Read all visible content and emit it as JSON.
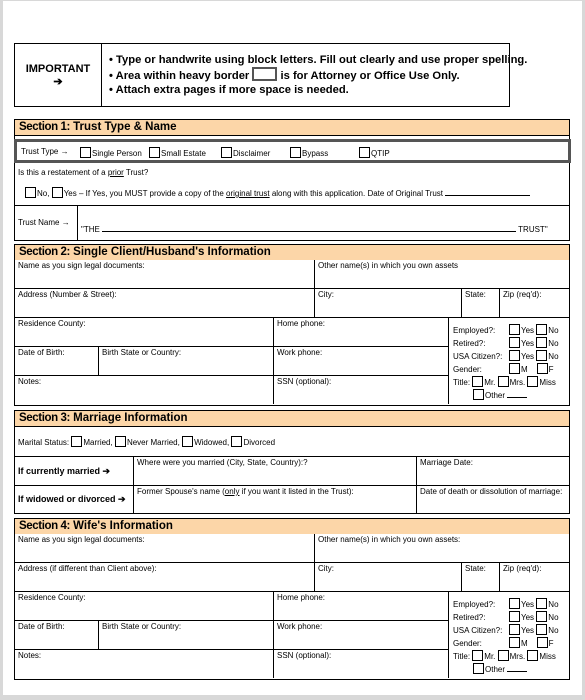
{
  "important": {
    "label": "IMPORTANT",
    "arrow": "➔",
    "bullets": [
      "Type or handwrite using block letters. Fill out clearly and use proper spelling.",
      "Area within heavy border",
      "is for Attorney or Office Use Only.",
      "Attach extra pages if more space is needed."
    ],
    "bullet_char": "•"
  },
  "section1": {
    "number": "Section 1:",
    "title": "Trust Type & Name",
    "trust_type_label": "Trust Type →",
    "trust_types": [
      "Single Person",
      "Small Estate",
      "Disclaimer",
      "Bypass",
      "QTIP"
    ],
    "restatement_q_pre": "Is this a restatement of a ",
    "restatement_q_ul": "prior",
    "restatement_q_post": " Trust?",
    "no_label": "No,",
    "yes_label": "Yes",
    "yes_text_pre": " – If Yes, you MUST provide a copy of the ",
    "yes_text_ul": "original trust",
    "yes_text_post": " along with this application. Date of Original Trust",
    "trust_name_label": "Trust Name →",
    "trust_name_prefix": "\"THE",
    "trust_name_suffix": "TRUST\""
  },
  "section2": {
    "number": "Section 2:",
    "title": "Single Client/Husband's Information",
    "name_label": "Name as you sign legal documents:",
    "other_names_label": "Other name(s) in which you own assets",
    "address_label": "Address (Number & Street):",
    "city_label": "City:",
    "state_label": "State:",
    "zip_label": "Zip (req'd):",
    "county_label": "Residence County:",
    "home_phone_label": "Home phone:",
    "dob_label": "Date of Birth:",
    "birth_state_label": "Birth State or Country:",
    "work_phone_label": "Work phone:",
    "notes_label": "Notes:",
    "ssn_label": "SSN (optional):",
    "employed_label": "Employed?:",
    "retired_label": "Retired?:",
    "citizen_label": "USA Citizen?:",
    "gender_label": "Gender:",
    "title_label": "Title:",
    "yes": "Yes",
    "no": "No",
    "m": "M",
    "f": "F",
    "titles": [
      "Mr.",
      "Mrs.",
      "Miss"
    ],
    "other": "Other"
  },
  "section3": {
    "number": "Section 3:",
    "title": "Marriage Information",
    "marital_label": "Marital Status:",
    "statuses": [
      "Married,",
      "Never Married,",
      "Widowed,",
      "Divorced"
    ],
    "currently_married_label": "If currently married ➔",
    "where_married_label": "Where were you married (City, State, Country):?",
    "marriage_date_label": "Marriage Date:",
    "widowed_label": "If widowed or divorced ➔",
    "former_spouse_pre": "Former Spouse's name (",
    "former_spouse_ul": "only",
    "former_spouse_post": " if you want it listed in the Trust):",
    "death_date_label": "Date of death or dissolution of marriage:"
  },
  "section4": {
    "number": "Section 4:",
    "title": "Wife's Information",
    "name_label": "Name as you sign legal documents:",
    "other_names_label": "Other name(s) in which you own assets:",
    "address_label": "Address (if different than Client above):",
    "city_label": "City:",
    "state_label": "State:",
    "zip_label": "Zip (req'd):",
    "county_label": "Residence County:",
    "home_phone_label": "Home phone:",
    "dob_label": "Date of Birth:",
    "birth_state_label": "Birth State or Country:",
    "work_phone_label": "Work phone:",
    "notes_label": "Notes:",
    "ssn_label": "SSN (optional):",
    "employed_label": "Employed?:",
    "retired_label": "Retired?:",
    "citizen_label": "USA Citizen?:",
    "gender_label": "Gender:",
    "title_label": "Title:",
    "yes": "Yes",
    "no": "No",
    "m": "M",
    "f": "F",
    "titles": [
      "Mr.",
      "Mrs.",
      "Miss"
    ],
    "other": "Other"
  },
  "colors": {
    "section_header_bg": "#fcd6a8",
    "frame_gray": "#d8d8d8",
    "heavy_border": "#555555"
  }
}
